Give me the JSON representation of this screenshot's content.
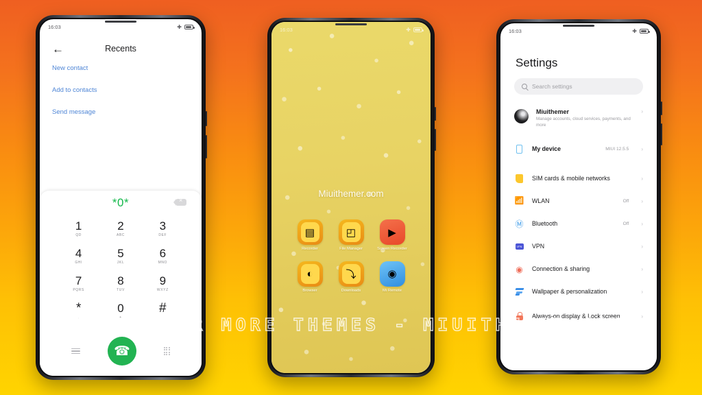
{
  "watermark": {
    "text": "VISIT  FOR  MORE  THEMES  -  MIUITHEMER.COM"
  },
  "status_bar": {
    "time": "16:03",
    "airplane_icon": "airplane-mode-icon",
    "battery_icon": "battery-icon"
  },
  "phone_dialer": {
    "header": {
      "back_icon": "back-arrow-icon",
      "title": "Recents"
    },
    "actions": [
      {
        "label": "New contact"
      },
      {
        "label": "Add to contacts"
      },
      {
        "label": "Send message"
      }
    ],
    "display": {
      "number": "*0*",
      "backspace_icon": "backspace-icon"
    },
    "keys": [
      {
        "digit": "1",
        "letters": "QD"
      },
      {
        "digit": "2",
        "letters": "ABC"
      },
      {
        "digit": "3",
        "letters": "DEF"
      },
      {
        "digit": "4",
        "letters": "GHI"
      },
      {
        "digit": "5",
        "letters": "JKL"
      },
      {
        "digit": "6",
        "letters": "MNO"
      },
      {
        "digit": "7",
        "letters": "PQRS"
      },
      {
        "digit": "8",
        "letters": "TUV"
      },
      {
        "digit": "9",
        "letters": "WXYZ"
      },
      {
        "digit": "*",
        "letters": ","
      },
      {
        "digit": "0",
        "letters": "+"
      },
      {
        "digit": "#",
        "letters": ""
      }
    ],
    "bottom_bar": {
      "menu_icon": "menu-icon",
      "call_icon": "call-icon",
      "keypad_icon": "keypad-icon"
    },
    "accent_green": "#22b352",
    "link_blue": "#4f86d6"
  },
  "phone_home": {
    "wallpaper_watermark": "Miuithemer.com",
    "apps": [
      {
        "label": "Recorder",
        "icon": "recorder-app-icon",
        "glyph": "▤",
        "style": "toon"
      },
      {
        "label": "File Manager",
        "icon": "file-manager-app-icon",
        "glyph": "◰",
        "style": "toon"
      },
      {
        "label": "Screen Recorder",
        "icon": "screen-recorder-app-icon",
        "glyph": "▶",
        "style": "red"
      },
      {
        "label": "Browser",
        "icon": "browser-app-icon",
        "glyph": "◐",
        "style": "toon"
      },
      {
        "label": "Downloads",
        "icon": "downloads-app-icon",
        "glyph": "⤵",
        "style": "toon"
      },
      {
        "label": "Mi Remote",
        "icon": "mi-remote-app-icon",
        "glyph": "◉",
        "style": "blue"
      }
    ]
  },
  "phone_settings": {
    "title": "Settings",
    "search": {
      "placeholder": "Search settings",
      "icon": "search-icon"
    },
    "account": {
      "name": "Miuithemer",
      "subtitle": "Manage accounts, cloud services, payments, and more",
      "avatar": "account-avatar"
    },
    "items": [
      {
        "label": "My device",
        "value": "MIUI 12.5.5",
        "icon": "device-icon",
        "bold": true
      },
      {
        "label": "SIM cards & mobile networks",
        "value": "",
        "icon": "sim-card-icon",
        "bold": false
      },
      {
        "label": "WLAN",
        "value": "Off",
        "icon": "wifi-icon",
        "bold": false
      },
      {
        "label": "Bluetooth",
        "value": "Off",
        "icon": "bluetooth-icon",
        "bold": false
      },
      {
        "label": "VPN",
        "value": "",
        "icon": "vpn-icon",
        "bold": false
      },
      {
        "label": "Connection & sharing",
        "value": "",
        "icon": "connection-sharing-icon",
        "bold": false
      },
      {
        "label": "Wallpaper & personalization",
        "value": "",
        "icon": "wallpaper-icon",
        "bold": false
      },
      {
        "label": "Always-on display & Lock screen",
        "value": "",
        "icon": "lock-icon",
        "bold": false
      }
    ],
    "vpn_badge_text": "VPN"
  }
}
